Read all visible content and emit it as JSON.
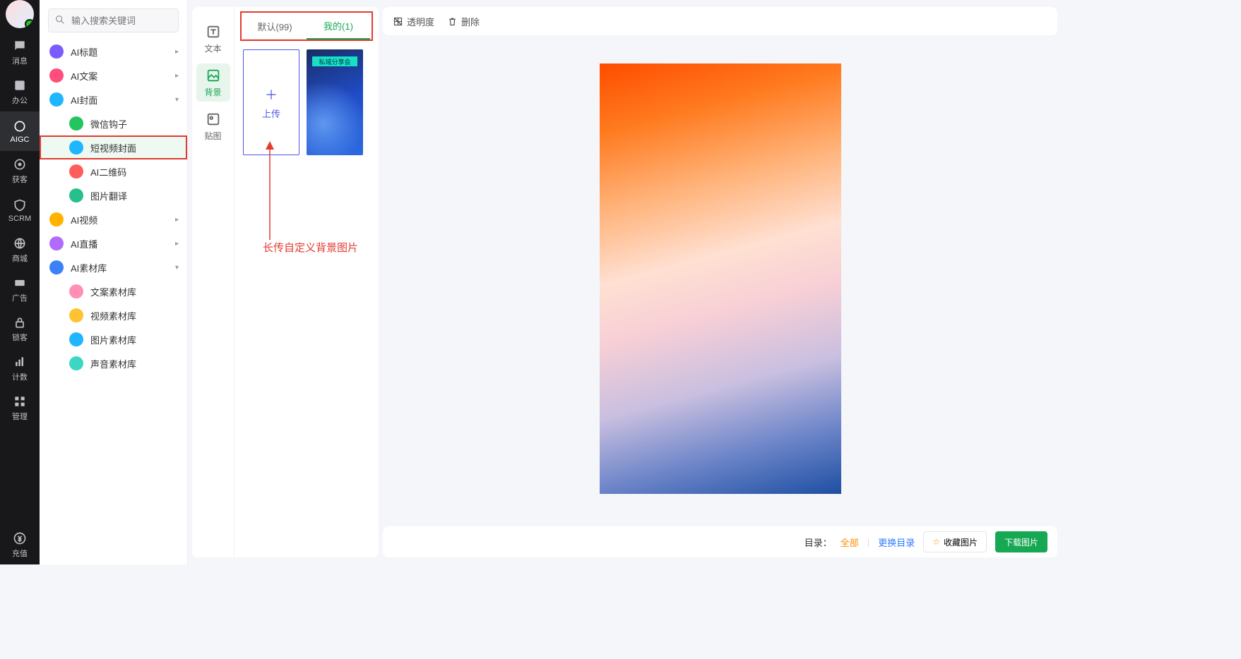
{
  "search": {
    "placeholder": "输入搜索关键词"
  },
  "rail": [
    {
      "label": "消息",
      "active": false
    },
    {
      "label": "办公",
      "active": false
    },
    {
      "label": "AIGC",
      "active": true
    },
    {
      "label": "获客",
      "active": false
    },
    {
      "label": "SCRM",
      "active": false
    },
    {
      "label": "商城",
      "active": false
    },
    {
      "label": "广告",
      "active": false
    },
    {
      "label": "锁客",
      "active": false
    },
    {
      "label": "计数",
      "active": false
    },
    {
      "label": "管理",
      "active": false
    }
  ],
  "rail_bottom": {
    "label": "充值"
  },
  "menu": [
    {
      "label": "AI标题",
      "icon": "#7b5cff",
      "expand": true
    },
    {
      "label": "AI文案",
      "icon": "#ff4d7d",
      "expand": true
    },
    {
      "label": "AI封面",
      "icon": "#1eb6ff",
      "expand": true,
      "open": true,
      "children": [
        {
          "label": "微信钩子",
          "icon": "#22c55e"
        },
        {
          "label": "短视频封面",
          "icon": "#1eb6ff",
          "selected": true
        },
        {
          "label": "AI二维码",
          "icon": "#ff5c5c"
        },
        {
          "label": "图片翻译",
          "icon": "#27c08a"
        }
      ]
    },
    {
      "label": "AI视频",
      "icon": "#ffb300",
      "expand": true
    },
    {
      "label": "AI直播",
      "icon": "#b06bff",
      "expand": true
    },
    {
      "label": "AI素材库",
      "icon": "#3b82f6",
      "expand": true,
      "open": true,
      "children": [
        {
          "label": "文案素材库",
          "icon": "#ff8fb3"
        },
        {
          "label": "视频素材库",
          "icon": "#ffc233"
        },
        {
          "label": "图片素材库",
          "icon": "#1eb6ff"
        },
        {
          "label": "声音素材库",
          "icon": "#3dd6c4"
        }
      ]
    }
  ],
  "tools": [
    {
      "label": "文本"
    },
    {
      "label": "背景",
      "active": true
    },
    {
      "label": "贴图"
    }
  ],
  "tabs": {
    "default": "默认(99)",
    "mine": "我的(1)"
  },
  "upload": {
    "plus": "＋",
    "label": "上传"
  },
  "thumb_tag": "私域分享会",
  "annotation": "长传自定义背景图片",
  "topbar": {
    "opacity": "透明度",
    "delete": "删除"
  },
  "footer": {
    "dir": "目录：",
    "all": "全部",
    "change": "更换目录",
    "fav": "收藏图片",
    "download": "下载图片"
  }
}
